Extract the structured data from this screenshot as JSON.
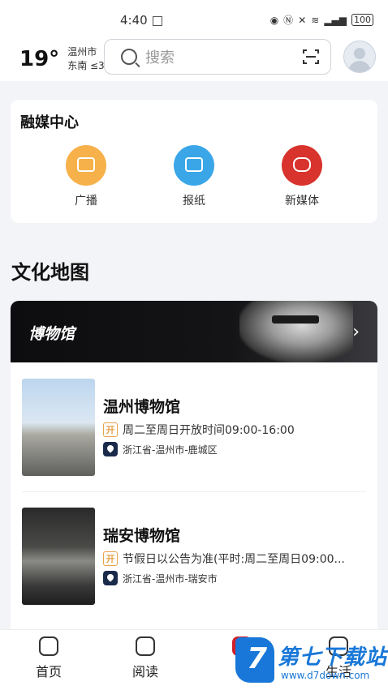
{
  "status_bar": {
    "time": "4:40",
    "battery": "100"
  },
  "header": {
    "temperature": "19°",
    "city": "温州市",
    "wind": "东南 ≤3",
    "search_placeholder": "搜索"
  },
  "media_center": {
    "title": "融媒中心",
    "items": [
      {
        "label": "广播",
        "icon": "radio-icon",
        "color": "#f6b14a"
      },
      {
        "label": "报纸",
        "icon": "newspaper-icon",
        "color": "#3aa6e8"
      },
      {
        "label": "新媒体",
        "icon": "new-media-icon",
        "color": "#d8332c"
      }
    ]
  },
  "culture_map": {
    "title": "文化地图",
    "banner_title": "博物馆",
    "museums": [
      {
        "name": "温州博物馆",
        "hours": "周二至周日开放时间09:00-16:00",
        "address": "浙江省-温州市-鹿城区"
      },
      {
        "name": "瑞安博物馆",
        "hours": "节假日以公告为准(平时:周二至周日09:00...",
        "address": "浙江省-温州市-瑞安市"
      }
    ]
  },
  "tabbar": {
    "tabs": [
      {
        "label": "首页",
        "icon": "home-icon"
      },
      {
        "label": "阅读",
        "icon": "book-icon"
      },
      {
        "label": "",
        "icon": "center-icon"
      },
      {
        "label": "生活",
        "icon": "life-icon"
      }
    ]
  },
  "watermark": {
    "text": "第七下载站",
    "url": "www.d7down.com"
  }
}
